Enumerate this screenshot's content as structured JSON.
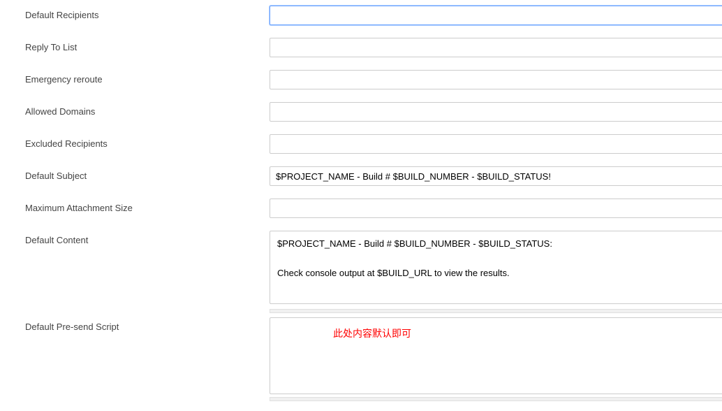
{
  "form": {
    "fields": {
      "default_recipients": {
        "label": "Default Recipients",
        "value": ""
      },
      "reply_to_list": {
        "label": "Reply To List",
        "value": ""
      },
      "emergency_reroute": {
        "label": "Emergency reroute",
        "value": ""
      },
      "allowed_domains": {
        "label": "Allowed Domains",
        "value": ""
      },
      "excluded_recipients": {
        "label": "Excluded Recipients",
        "value": ""
      },
      "default_subject": {
        "label": "Default Subject",
        "value": "$PROJECT_NAME - Build # $BUILD_NUMBER - $BUILD_STATUS!"
      },
      "max_attachment_size": {
        "label": "Maximum Attachment Size",
        "value": ""
      },
      "default_content": {
        "label": "Default Content",
        "value": "$PROJECT_NAME - Build # $BUILD_NUMBER - $BUILD_STATUS:\n\nCheck console output at $BUILD_URL to view the results."
      },
      "default_presend_script": {
        "label": "Default Pre-send Script",
        "value": ""
      }
    },
    "annotation": {
      "text": "此处内容默认即可",
      "color": "#ff0000"
    }
  }
}
